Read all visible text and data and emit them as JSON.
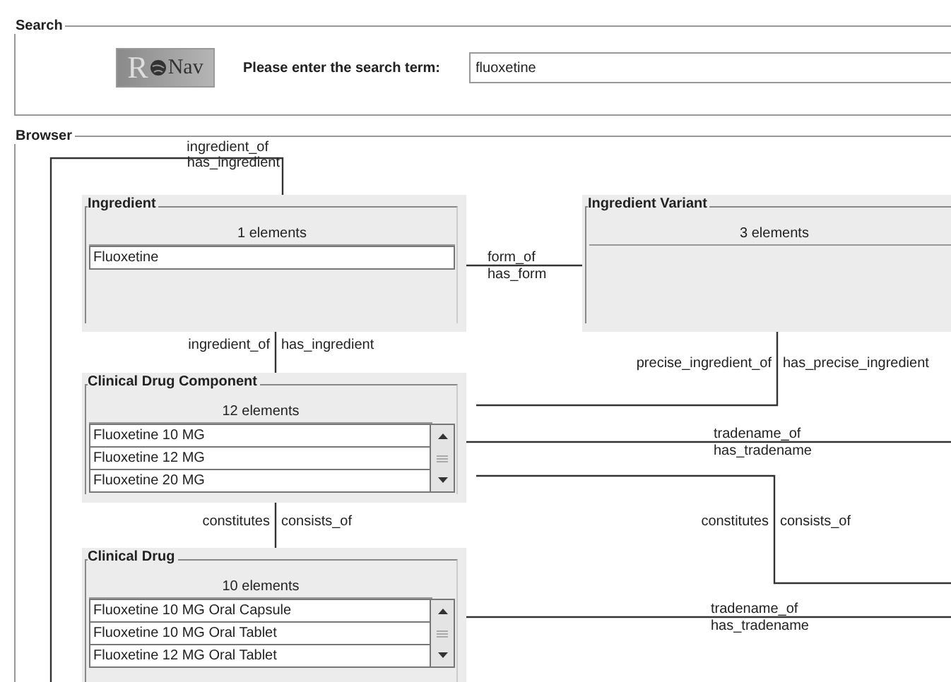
{
  "search": {
    "title": "Search",
    "logo": {
      "initial": "R",
      "name": "Nav"
    },
    "label": "Please enter the search term:",
    "value": "fluoxetine"
  },
  "browser": {
    "title": "Browser",
    "panels": [
      {
        "title": "Ingredient",
        "count": "1 elements",
        "scrollbar": false,
        "rows": [
          "Fluoxetine"
        ]
      },
      {
        "title": "Ingredient Variant",
        "count": "3 elements",
        "scrollbar": false
      },
      {
        "title": "Clinical Drug Component",
        "count": "12 elements",
        "scrollbar": true,
        "rows": [
          "Fluoxetine 10 MG",
          "Fluoxetine 12 MG",
          "Fluoxetine 20 MG"
        ]
      },
      {
        "title": "Clinical Drug",
        "count": "10 elements",
        "scrollbar": true,
        "rows": [
          "Fluoxetine 10 MG Oral Capsule",
          "Fluoxetine 10 MG Oral Tablet",
          "Fluoxetine 12 MG Oral Tablet"
        ]
      }
    ],
    "relations": [
      {
        "kind": "stacked",
        "forward": "ingredient_of",
        "inverse": "has_ingredient"
      },
      {
        "kind": "stacked",
        "forward": "form_of",
        "inverse": "has_form"
      },
      {
        "kind": "split",
        "forward": "ingredient_of",
        "inverse": "has_ingredient"
      },
      {
        "kind": "split",
        "forward": "precise_ingredient_of",
        "inverse": "has_precise_ingredient"
      },
      {
        "kind": "stacked",
        "forward": "tradename_of",
        "inverse": "has_tradename"
      },
      {
        "kind": "split",
        "forward": "constitutes",
        "inverse": "consists_of"
      },
      {
        "kind": "split",
        "forward": "constitutes",
        "inverse": "consists_of"
      },
      {
        "kind": "stacked",
        "forward": "tradename_of",
        "inverse": "has_tradename"
      }
    ]
  }
}
